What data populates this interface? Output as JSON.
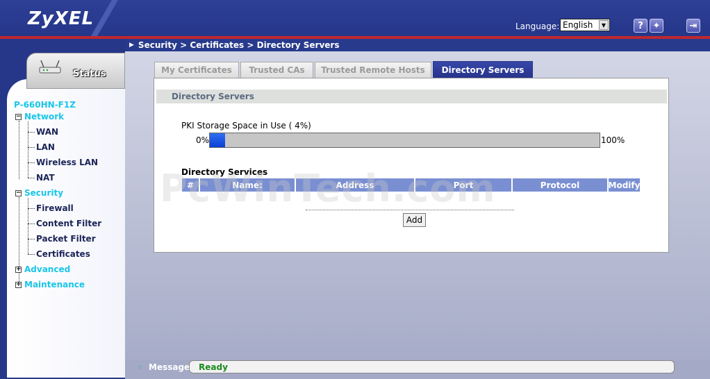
{
  "header": {
    "logo": "ZyXEL",
    "language_label": "Language:",
    "language_value": "English"
  },
  "sidebar": {
    "status_label": "Status",
    "model": "P-660HN-F1Z",
    "groups": [
      {
        "label": "Network",
        "expanded": true,
        "items": [
          "WAN",
          "LAN",
          "Wireless LAN",
          "NAT"
        ]
      },
      {
        "label": "Security",
        "expanded": true,
        "items": [
          "Firewall",
          "Content Filter",
          "Packet Filter",
          "Certificates"
        ]
      },
      {
        "label": "Advanced",
        "expanded": false,
        "items": []
      },
      {
        "label": "Maintenance",
        "expanded": false,
        "items": []
      }
    ]
  },
  "breadcrumb": "Security > Certificates > Directory Servers",
  "tabs": [
    {
      "label": "My Certificates",
      "active": false
    },
    {
      "label": "Trusted CAs",
      "active": false
    },
    {
      "label": "Trusted Remote Hosts",
      "active": false
    },
    {
      "label": "Directory Servers",
      "active": true
    }
  ],
  "panel": {
    "title": "Directory Servers",
    "pki_label": "PKI Storage Space in Use ( 4%)",
    "pki_percent": 4,
    "pki_min_label": "0%",
    "pki_max_label": "100%",
    "services_title": "Directory Services",
    "table_headers": [
      "#",
      "Name:",
      "Address",
      "Port",
      "Protocol",
      "Modify"
    ],
    "add_button": "Add",
    "watermark": "PcWinTech.com"
  },
  "status": {
    "label": "Message",
    "value": "Ready"
  },
  "colors": {
    "header_blue": "#283a8c",
    "accent_red": "#c1272d",
    "nav_cyan": "#19c6e8",
    "ready_green": "#1c8a1c",
    "table_header": "#7a8fd2"
  }
}
